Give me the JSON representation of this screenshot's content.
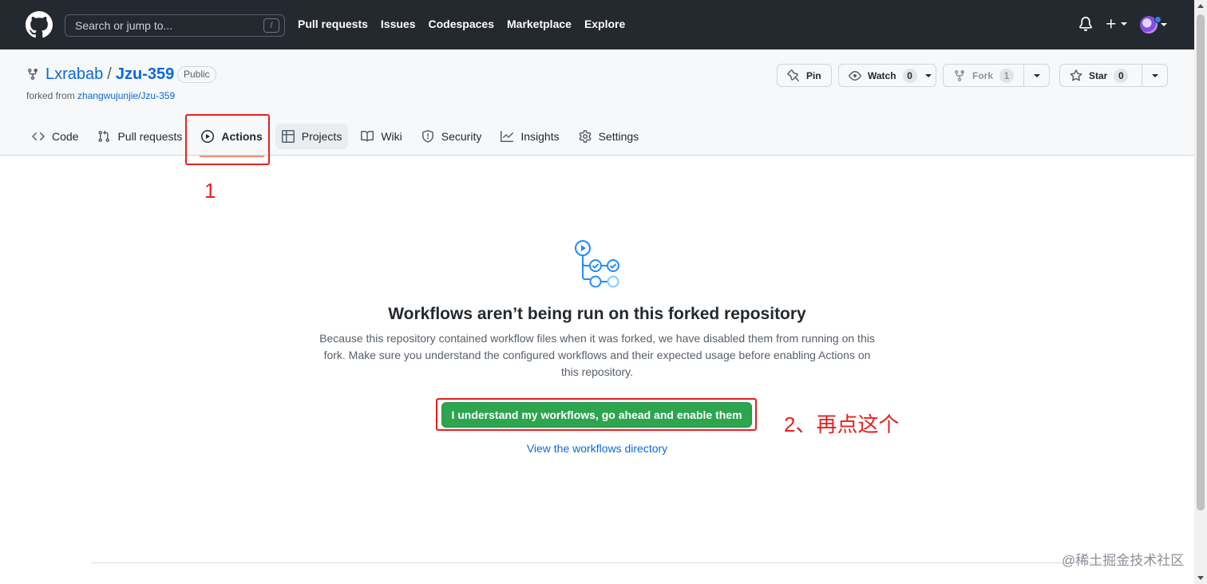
{
  "header": {
    "search_placeholder": "Search or jump to...",
    "search_shortcut": "/",
    "nav": [
      "Pull requests",
      "Issues",
      "Codespaces",
      "Marketplace",
      "Explore"
    ]
  },
  "repo": {
    "owner": "Lxrabab",
    "separator": "/",
    "name": "Jzu-359",
    "visibility": "Public",
    "forked_prefix": "forked from",
    "forked_source": "zhangwujunjie/Jzu-359",
    "pin_label": "Pin",
    "watch_label": "Watch",
    "watch_count": "0",
    "fork_label": "Fork",
    "fork_count": "1",
    "star_label": "Star",
    "star_count": "0"
  },
  "tabs": [
    {
      "label": "Code",
      "icon": "code-icon"
    },
    {
      "label": "Pull requests",
      "icon": "git-pull-request-icon"
    },
    {
      "label": "Actions",
      "icon": "play-icon",
      "active": true
    },
    {
      "label": "Projects",
      "icon": "table-icon"
    },
    {
      "label": "Wiki",
      "icon": "book-icon"
    },
    {
      "label": "Security",
      "icon": "shield-icon"
    },
    {
      "label": "Insights",
      "icon": "graph-icon"
    },
    {
      "label": "Settings",
      "icon": "gear-icon"
    }
  ],
  "annotations": {
    "step1": "1",
    "step2": "2、再点这个"
  },
  "blankslate": {
    "title": "Workflows aren’t being run on this forked repository",
    "description": "Because this repository contained workflow files when it was forked, we have disabled them from running on this fork. Make sure you understand the configured workflows and their expected usage before enabling Actions on this repository.",
    "enable_button": "I understand my workflows, go ahead and enable them",
    "link": "View the workflows directory"
  },
  "watermark": "@稀土掘金技术社区",
  "colors": {
    "header_bg": "#24292f",
    "link": "#0969da",
    "primary_button": "#2da44e",
    "annotation_red": "#e81f1f",
    "tab_underline": "#fd8c73",
    "workflow_icon_blue": "#218bff"
  }
}
